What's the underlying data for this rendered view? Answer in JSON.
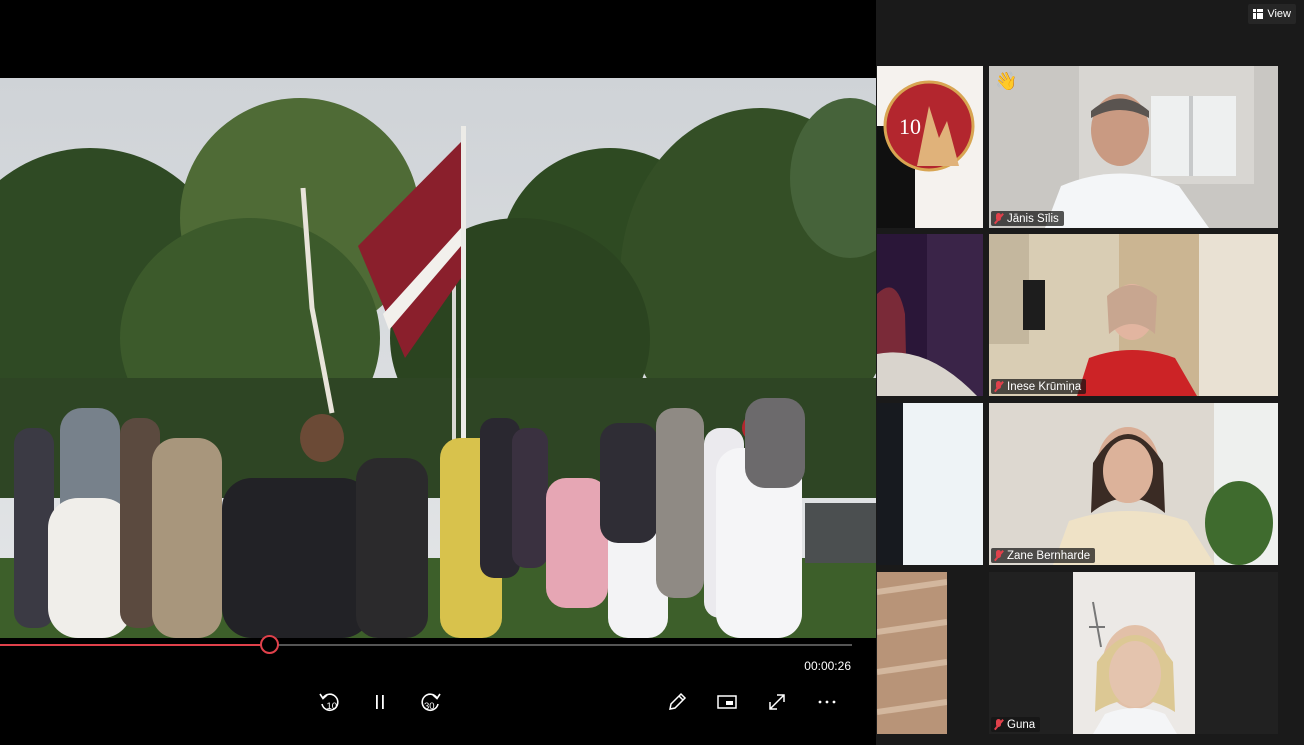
{
  "player": {
    "progress": 0.316,
    "elapsed_time": "00:00:26",
    "controls": {
      "rewind_icon": "rewind-10-icon",
      "rewind_label": "10",
      "pause_icon": "pause-icon",
      "forward_icon": "forward-30-icon",
      "forward_label": "30",
      "draw_icon": "pencil-icon",
      "mini_icon": "mini-view-icon",
      "fullscreen_icon": "expand-icon",
      "more_icon": "more-icon"
    },
    "accent_color": "#e0414b"
  },
  "panel": {
    "view_label": "View",
    "view_icon": "grid-icon",
    "participants": [
      {
        "name": "Jānis Sīlis",
        "muted": true,
        "reaction": "👋"
      },
      {
        "name": "Inese Krūmiņa",
        "muted": true
      },
      {
        "name": "Zane Bernharde",
        "muted": true
      },
      {
        "name": "Guna",
        "muted": true
      }
    ],
    "logo_number": "10"
  }
}
